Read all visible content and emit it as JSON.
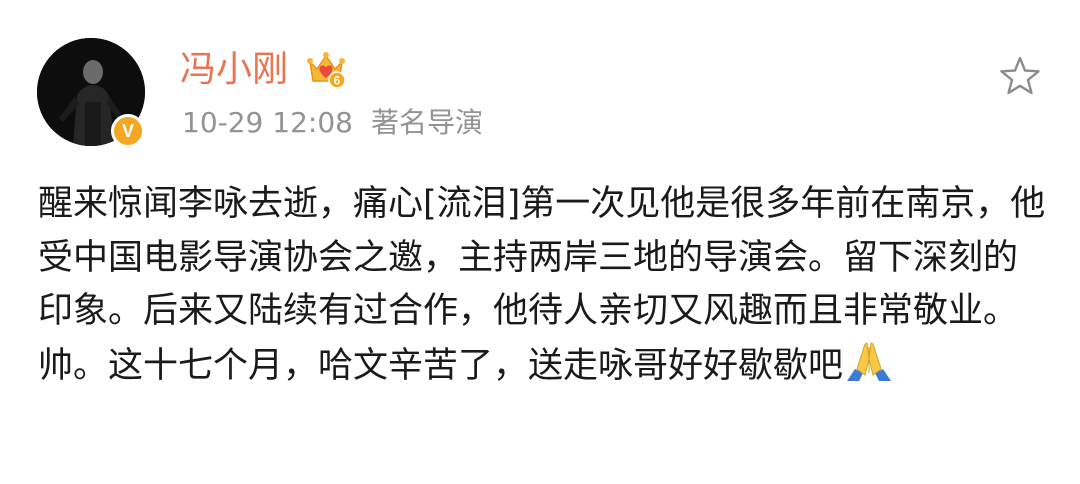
{
  "post": {
    "author": {
      "name": "冯小刚",
      "vip_icon": "crown-vip-icon",
      "vip_level": "6",
      "verified_icon": "verified-v-icon",
      "verified_mark": "V"
    },
    "time": "10-29 12:08",
    "description": "著名导演",
    "favorite_icon": "star-outline-icon",
    "body": "醒来惊闻李咏去逝，痛心[流泪]第一次见他是很多年前在南京，他受中国电影导演协会之邀，主持两岸三地的导演会。留下深刻的印象。后来又陆续有过合作，他待人亲切又风趣而且非常敬业。帅。这十七个月，哈文辛苦了，送走咏哥好好歇歇吧",
    "emoji": "praying-hands-icon"
  },
  "colors": {
    "username": "#eb7350",
    "meta": "#939393",
    "verified": "#f5a623",
    "body_text": "#1a1a1a"
  }
}
